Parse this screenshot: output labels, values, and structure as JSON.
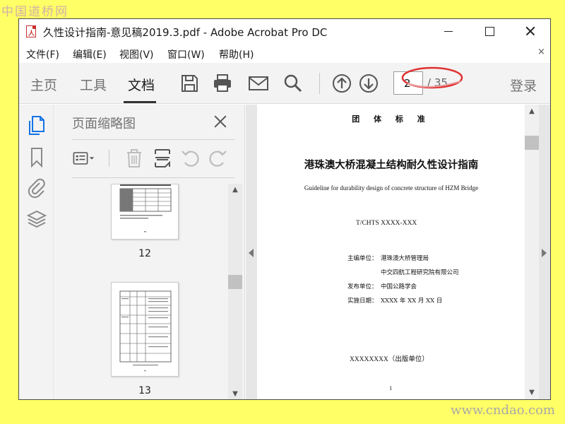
{
  "watermark": {
    "top": "中国道桥网",
    "bottom": "www.cndao.com"
  },
  "window": {
    "title": "久性设计指南-意见稿2019.3.pdf - Adobe Acrobat Pro DC"
  },
  "menu": {
    "items": [
      {
        "label": "文件(F)"
      },
      {
        "label": "编辑(E)"
      },
      {
        "label": "视图(V)"
      },
      {
        "label": "窗口(W)"
      },
      {
        "label": "帮助(H)"
      }
    ],
    "close_glyph": "×"
  },
  "toolbar": {
    "tabs": [
      {
        "label": "主页",
        "active": false
      },
      {
        "label": "工具",
        "active": false
      },
      {
        "label": "文档",
        "active": true
      }
    ],
    "icons": [
      "save-icon",
      "print-icon",
      "email-icon",
      "search-icon",
      "page-up-icon",
      "page-down-icon"
    ],
    "page_current": "2",
    "page_total": "/ 35",
    "login_label": "登录",
    "annotation_color": "#e03030"
  },
  "leftnav": {
    "icons": [
      "page-thumbnails-icon",
      "bookmark-icon",
      "attachment-icon",
      "layers-icon"
    ],
    "accent": "#1473e6"
  },
  "thumbnails_panel": {
    "title": "页面缩略图",
    "tools": [
      "page-options-icon",
      "delete-icon",
      "insert-page-icon",
      "rotate-left-icon",
      "rotate-right-icon"
    ],
    "pages": [
      {
        "number": "12"
      },
      {
        "number": "13"
      }
    ]
  },
  "document_page": {
    "header": "团 体 标 准",
    "title": "港珠澳大桥混凝土结构耐久性设计指南",
    "subtitle": "Guideline for durability design of concrete structure of HZM Bridge",
    "code": "T/CHTS    XXXX-XXX",
    "info": [
      {
        "label": "主编单位：",
        "value": "港珠澳大桥管理局"
      },
      {
        "label": "",
        "value": "中交四航工程研究院有限公司"
      },
      {
        "label": "发布单位：",
        "value": "中国公路学会"
      },
      {
        "label": "实施日期：",
        "value": "XXXX 年 XX 月 XX 日"
      }
    ],
    "publisher": "XXXXXXXX（出版单位）",
    "page_number": "1"
  }
}
